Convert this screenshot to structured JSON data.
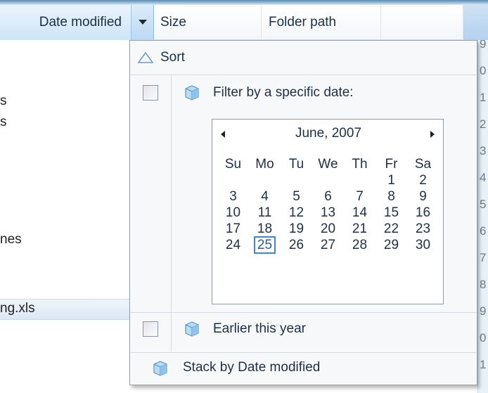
{
  "columns": {
    "date_modified": "Date modified",
    "size": "Size",
    "folder_path": "Folder path"
  },
  "left_fragments": [
    "s",
    "s",
    "nes",
    "ng.xls"
  ],
  "right_strip_digits": [
    "9",
    "0",
    "1",
    "2",
    "3",
    "4",
    "5",
    "6",
    "7",
    "8",
    "9",
    "0",
    "1"
  ],
  "menu": {
    "sort_label": "Sort",
    "filter_label": "Filter by a specific date:",
    "earlier_label": "Earlier this year",
    "stack_label": "Stack by Date modified"
  },
  "calendar": {
    "month_year": "June, 2007",
    "weekdays": [
      "Su",
      "Mo",
      "Tu",
      "We",
      "Th",
      "Fr",
      "Sa"
    ],
    "days": [
      "",
      "",
      "",
      "",
      "",
      "1",
      "2",
      "3",
      "4",
      "5",
      "6",
      "7",
      "8",
      "9",
      "10",
      "11",
      "12",
      "13",
      "14",
      "15",
      "16",
      "17",
      "18",
      "19",
      "20",
      "21",
      "22",
      "23",
      "24",
      "25",
      "26",
      "27",
      "28",
      "29",
      "30"
    ],
    "selected_day": "25"
  },
  "colors": {
    "accent": "#3e86cf",
    "header_active": "#cfe5f8",
    "menu_background": "#f7f8fa"
  }
}
